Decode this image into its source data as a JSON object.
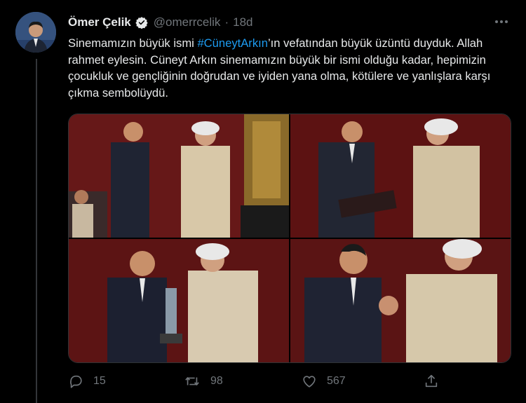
{
  "tweet": {
    "author_name": "Ömer Çelik",
    "handle": "@omerrcelik",
    "separator": "·",
    "time": "18d",
    "text_before": "Sinemamızın büyük ismi ",
    "hashtag": "#CüneytArkın",
    "text_after": "’ın vefatından büyük üzüntü duyduk. Allah rahmet eylesin. Cüneyt Arkın sinemamızın büyük bir ismi olduğu kadar, hepimizin çocukluk ve gençliğinin doğrudan ve iyiden yana olma, kötülere ve yanlışlara karşı çıkma sembolüydü."
  },
  "actions": {
    "reply_count": "15",
    "retweet_count": "98",
    "like_count": "567"
  },
  "icons": {
    "verified": "verified-badge-icon",
    "more": "more-icon",
    "reply": "reply-icon",
    "retweet": "retweet-icon",
    "like": "heart-icon",
    "share": "share-icon"
  },
  "colors": {
    "background": "#000000",
    "text": "#e7e9ea",
    "muted": "#71767b",
    "accent": "#1d9bf0"
  }
}
